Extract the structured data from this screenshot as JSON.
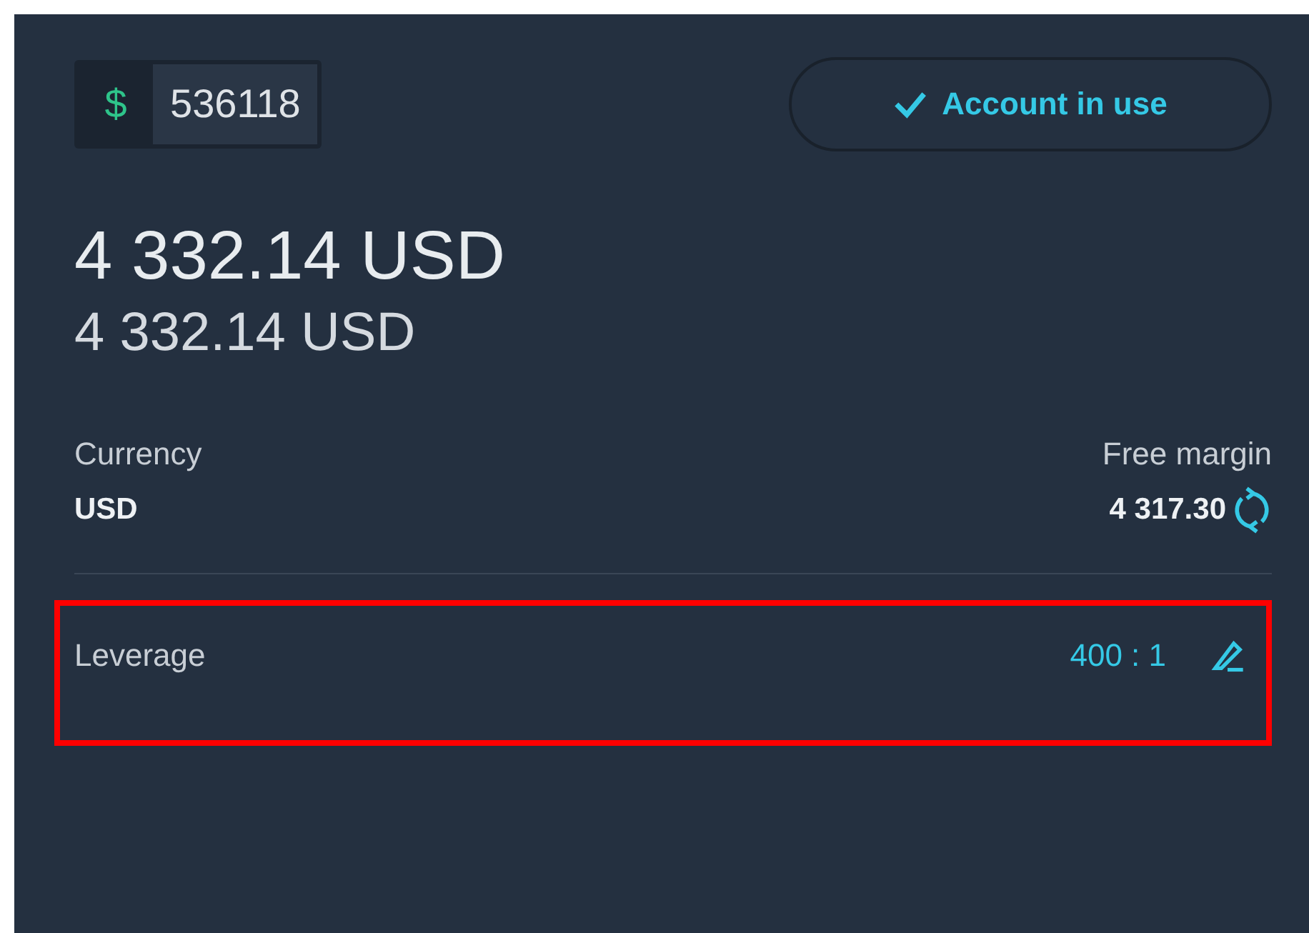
{
  "account": {
    "currency_symbol": "$",
    "number": "536118"
  },
  "status_button": {
    "label": "Account in use",
    "selected": true
  },
  "balance": "4 332.14 USD",
  "equity": "4 332.14 USD",
  "currency": {
    "label": "Currency",
    "value": "USD"
  },
  "free_margin": {
    "label": "Free margin",
    "value": "4 317.30"
  },
  "leverage": {
    "label": "Leverage",
    "value": "400 : 1",
    "highlighted": true
  }
}
